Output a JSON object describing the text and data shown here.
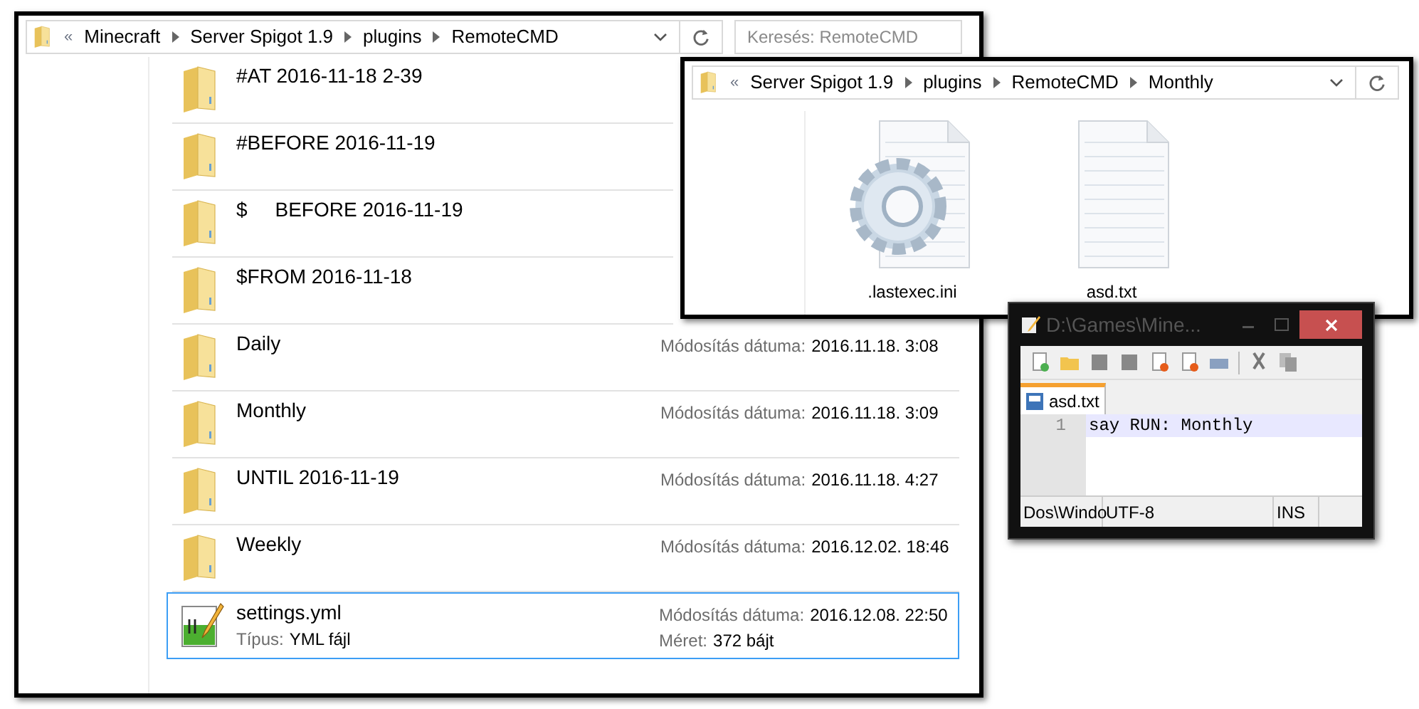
{
  "explorer": {
    "overflow": "«",
    "breadcrumb": [
      "Minecraft",
      "Server Spigot 1.9",
      "plugins",
      "RemoteCMD"
    ],
    "search": {
      "placeholder": "Keresés: RemoteCMD"
    },
    "rows": [
      {
        "kind": "folder",
        "name": "#AT 2016-11-18 2-39",
        "selected": false
      },
      {
        "kind": "folder",
        "name": "#BEFORE 2016-11-19",
        "selected": false
      },
      {
        "kind": "folder",
        "name": "$     BEFORE 2016-11-19",
        "selected": false
      },
      {
        "kind": "folder",
        "name": "$FROM 2016-11-18",
        "selected": false
      },
      {
        "kind": "folder",
        "name": "Daily",
        "detail_label": "Módosítás dátuma:",
        "detail_value": "2016.11.18. 3:08",
        "selected": false
      },
      {
        "kind": "folder",
        "name": "Monthly",
        "detail_label": "Módosítás dátuma:",
        "detail_value": "2016.11.18. 3:09",
        "selected": false
      },
      {
        "kind": "folder",
        "name": "UNTIL 2016-11-19",
        "detail_label": "Módosítás dátuma:",
        "detail_value": "2016.11.18. 4:27",
        "selected": false
      },
      {
        "kind": "folder",
        "name": "Weekly",
        "detail_label": "Módosítás dátuma:",
        "detail_value": "2016.12.02. 18:46",
        "selected": false
      },
      {
        "kind": "file",
        "name": "settings.yml",
        "detail_label": "Módosítás dátuma:",
        "detail_value": "2016.12.08. 22:50",
        "type_label": "Típus:",
        "type_value": "YML fájl",
        "size_label": "Méret:",
        "size_value": "372 bájt",
        "selected": true
      }
    ]
  },
  "explorer2": {
    "overflow": "«",
    "breadcrumb": [
      "Server Spigot 1.9",
      "plugins",
      "RemoteCMD",
      "Monthly"
    ],
    "files": [
      {
        "kind": "settings",
        "name": ".lastexec.ini"
      },
      {
        "kind": "text",
        "name": "asd.txt"
      }
    ]
  },
  "editor": {
    "title": "D:\\Games\\Mine...",
    "tab": "asd.txt",
    "lines": [
      {
        "number": "1",
        "text": "say RUN: Monthly"
      }
    ],
    "status": [
      "Dos\\Windo",
      "UTF-8",
      "INS"
    ]
  }
}
